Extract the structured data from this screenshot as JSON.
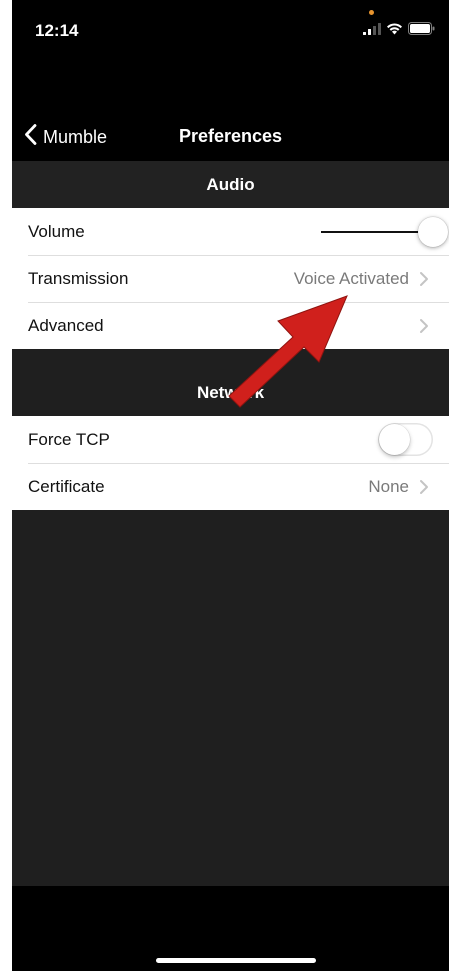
{
  "status_bar": {
    "time": "12:14",
    "icons": [
      "signal-icon",
      "wifi-icon",
      "battery-icon"
    ]
  },
  "nav": {
    "back_label": "Mumble",
    "title": "Preferences"
  },
  "sections": {
    "audio": {
      "header": "Audio",
      "volume": {
        "label": "Volume",
        "level": 1.0
      },
      "transmission": {
        "label": "Transmission",
        "value": "Voice Activated"
      },
      "advanced": {
        "label": "Advanced"
      }
    },
    "network": {
      "header": "Network",
      "force_tcp": {
        "label": "Force TCP",
        "enabled": false
      },
      "certificate": {
        "label": "Certificate",
        "value": "None"
      }
    }
  },
  "colors": {
    "background": "#000000",
    "content_background": "#1f1f1f",
    "row_background": "#ffffff",
    "secondary_text": "#7a7a7a",
    "annotation_arrow": "#d0201c"
  }
}
